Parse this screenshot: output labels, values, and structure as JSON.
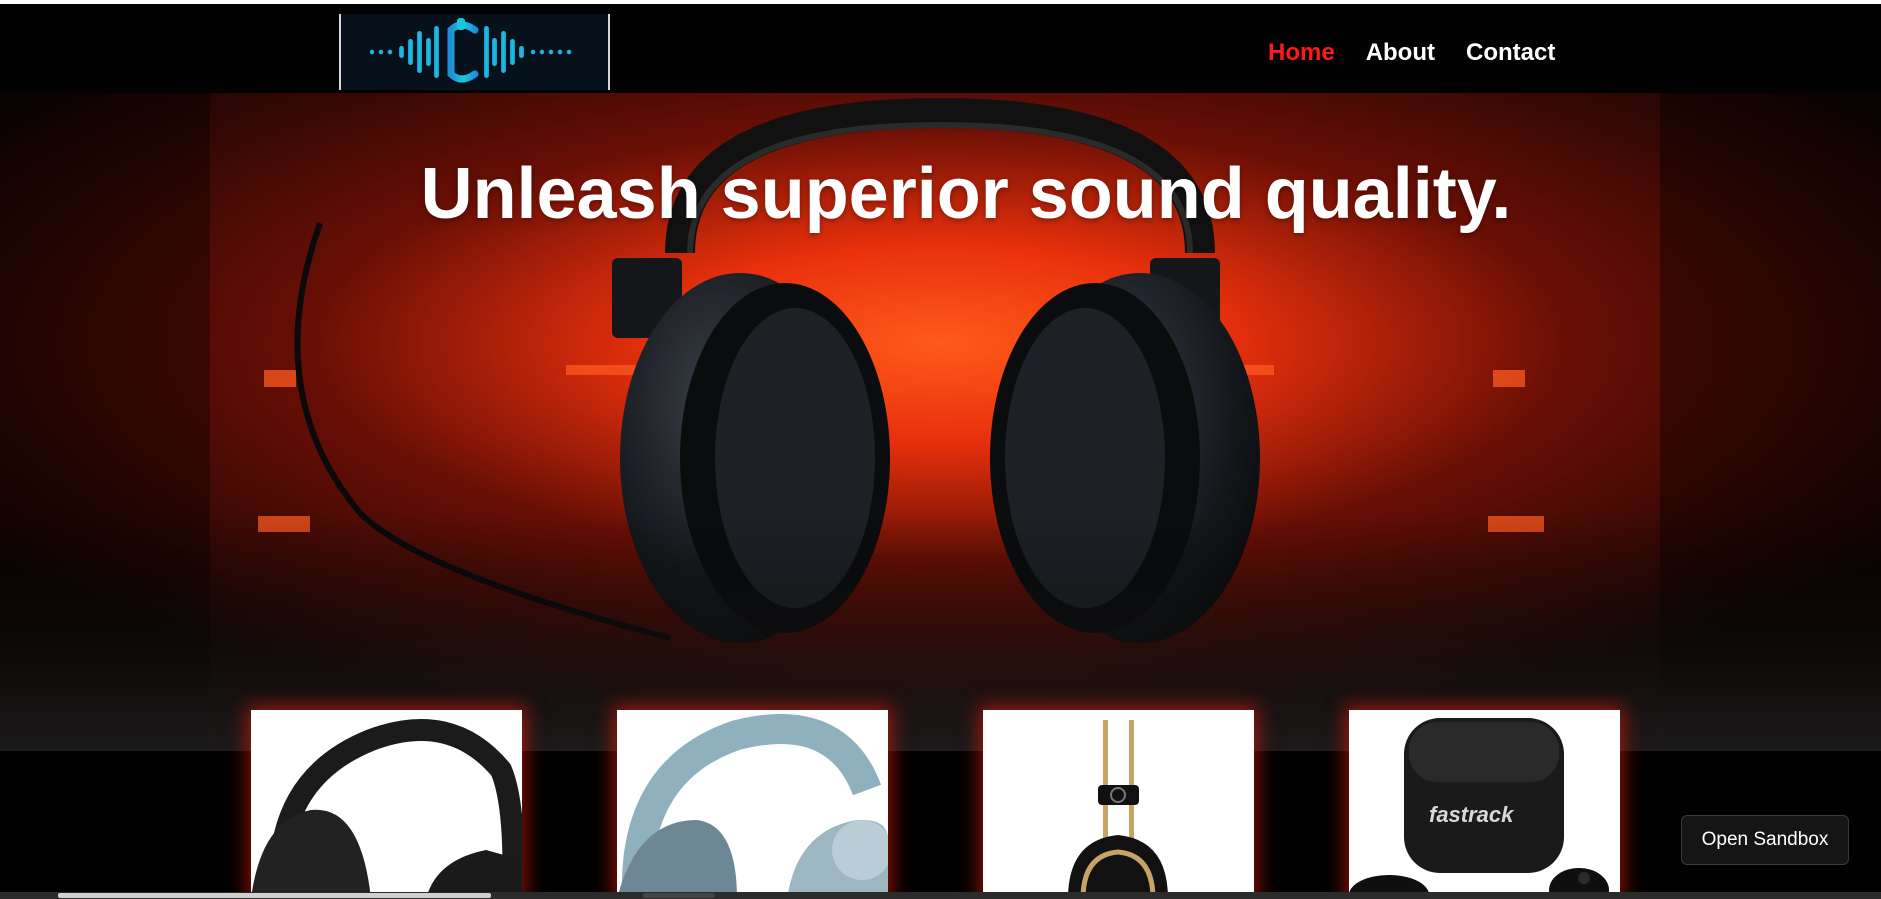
{
  "nav": {
    "logo_name": "waveform-c-logo",
    "items": [
      {
        "label": "Home",
        "active": true
      },
      {
        "label": "About",
        "active": false
      },
      {
        "label": "Contact",
        "active": false
      }
    ]
  },
  "hero": {
    "title": "Unleash superior sound quality.",
    "image": "headphones-hero-image"
  },
  "products": [
    {
      "image": "black-headphones-image"
    },
    {
      "image": "blue-headphones-image"
    },
    {
      "image": "gold-headphones-image"
    },
    {
      "image": "fastrack-earbuds-image",
      "brand": "fastrack"
    }
  ],
  "sandbox": {
    "label": "Open Sandbox"
  },
  "colors": {
    "accent": "#ff1a1a",
    "logo": "#18b8d8",
    "glow": "#ff3a10"
  }
}
